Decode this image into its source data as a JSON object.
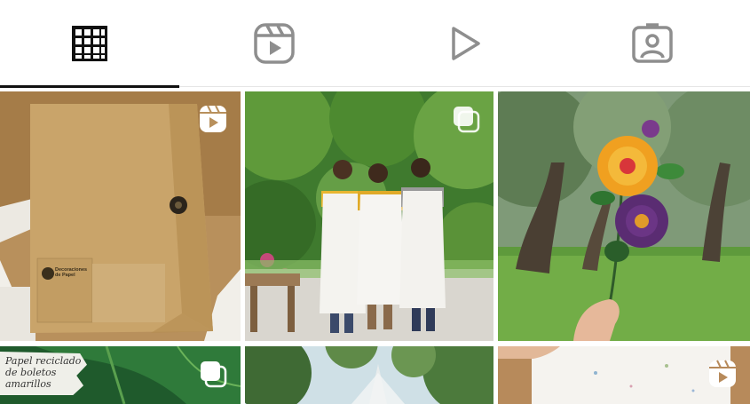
{
  "tabs": [
    {
      "id": "grid",
      "icon": "grid-icon",
      "active": true
    },
    {
      "id": "reels",
      "icon": "reels-icon",
      "active": false
    },
    {
      "id": "videos",
      "icon": "play-icon",
      "active": false
    },
    {
      "id": "tagged",
      "icon": "tagged-person-icon",
      "active": false
    }
  ],
  "posts": {
    "p1": {
      "badge": "reels-badge-icon",
      "logo_text": "Decoraciones\nde Papel"
    },
    "p2": {
      "badge": "carousel-badge-icon"
    },
    "p3": {
      "badge": ""
    },
    "p4": {
      "badge": "carousel-badge-icon",
      "caption": "Papel reciclado\nde boletos\namarillos"
    },
    "p5": {
      "badge": ""
    },
    "p6": {
      "badge": "reels-badge-icon"
    }
  },
  "colors": {
    "active_underline": "#111111",
    "tab_icon_active": "#111111",
    "tab_icon_inactive": "#8e8e8e"
  }
}
